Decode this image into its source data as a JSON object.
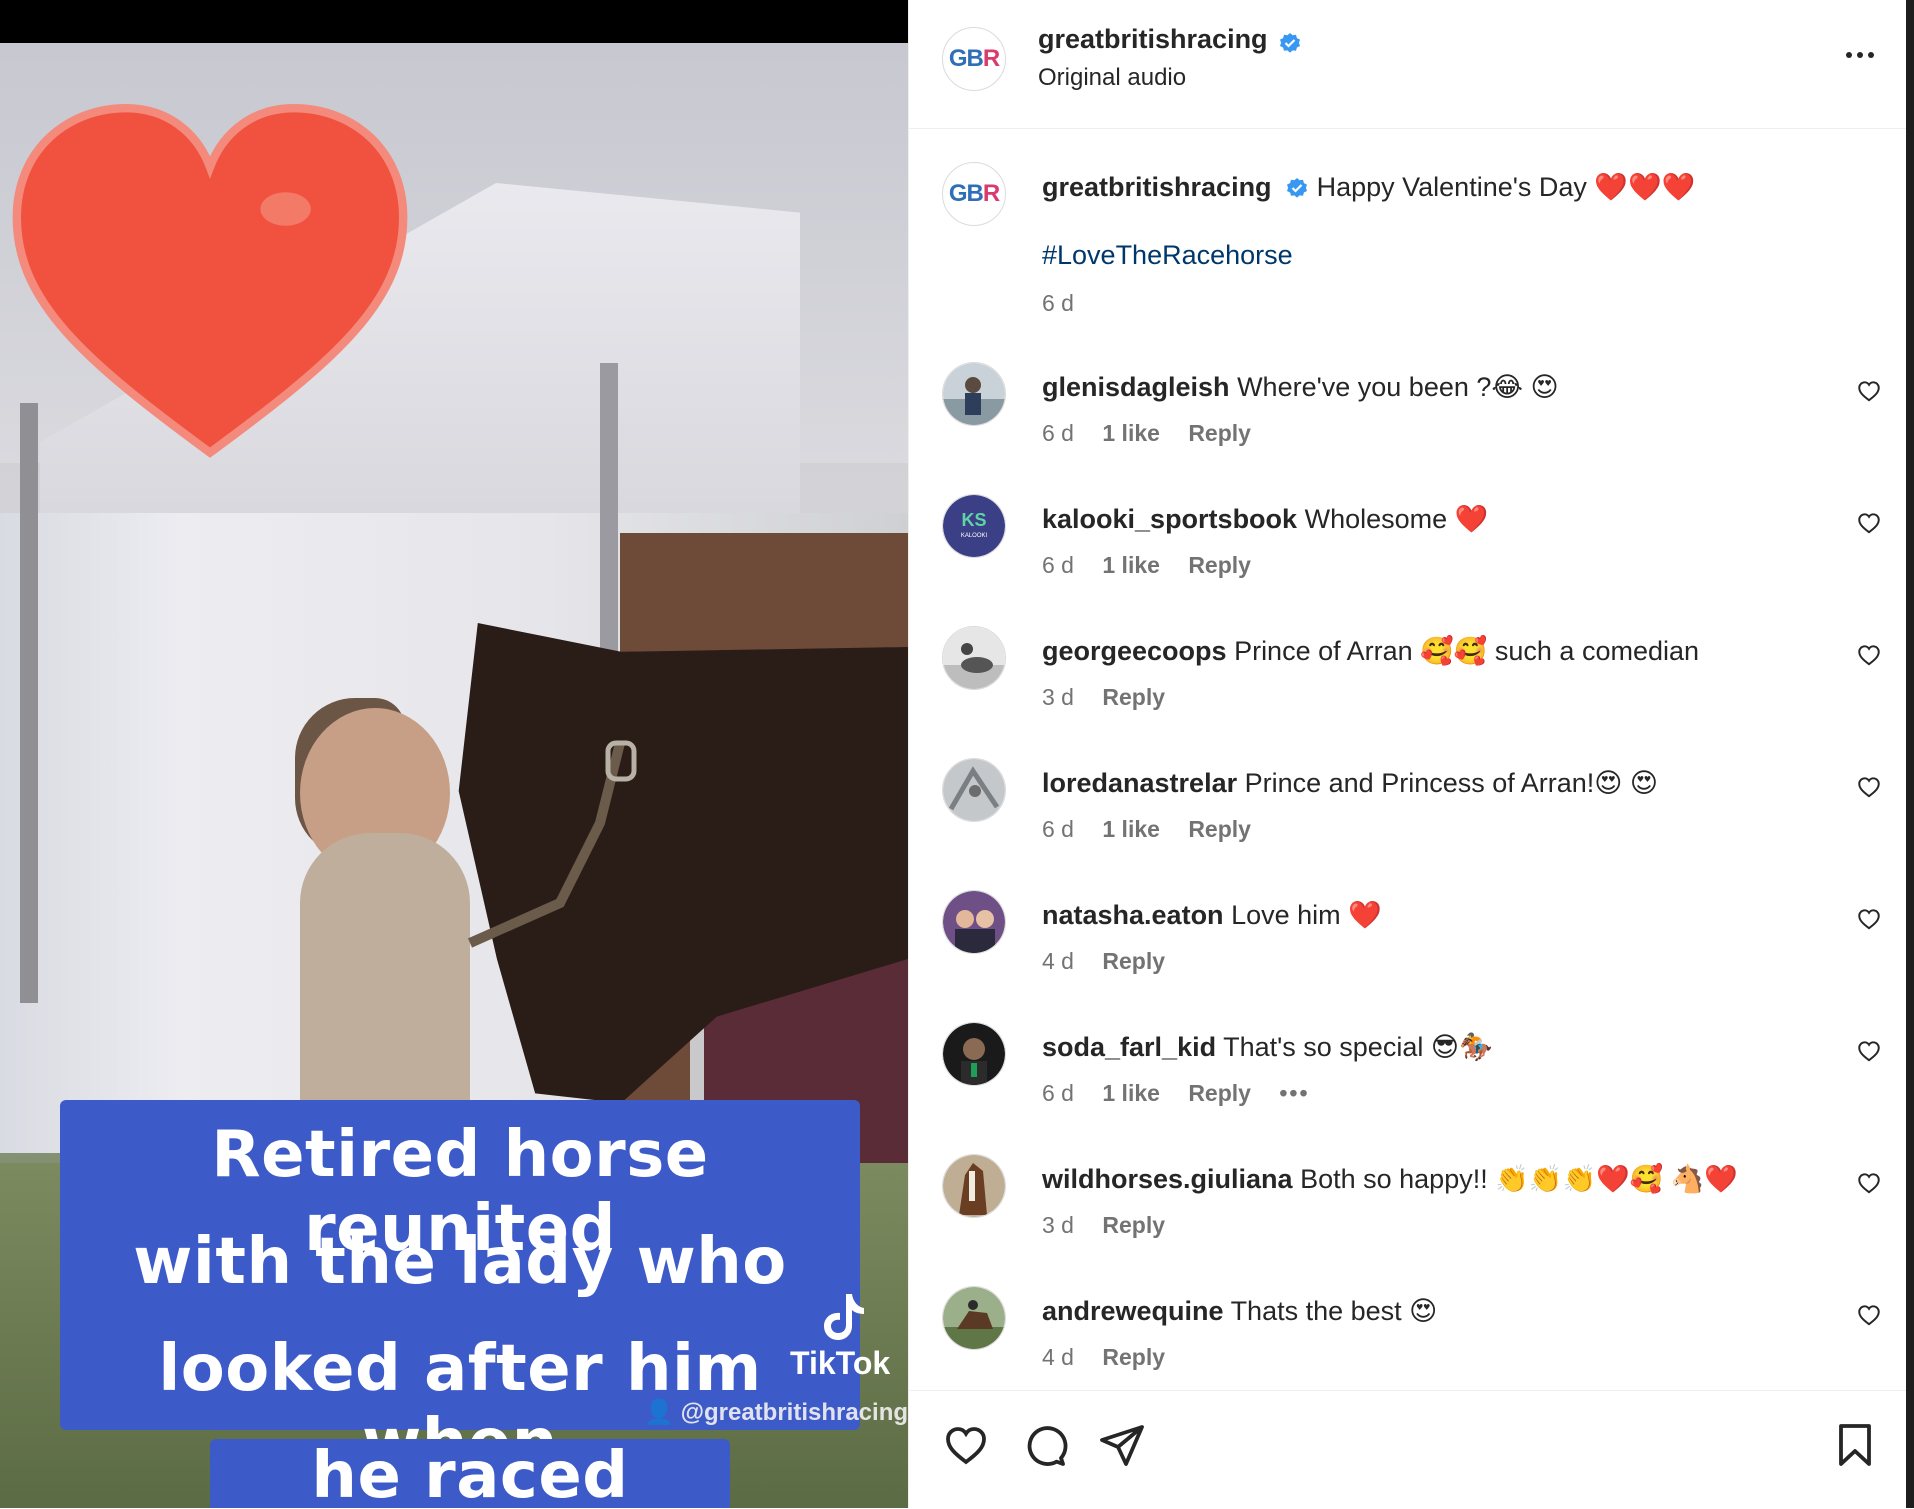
{
  "post": {
    "video_caption_lines": [
      "Retired horse reunited",
      "with the lady who",
      "looked after him when",
      "he raced"
    ],
    "tiktok_brand": "TikTok",
    "tiktok_handle": "@greatbritishracing"
  },
  "header": {
    "username": "greatbritishracing",
    "subtitle": "Original audio",
    "avatar_text": "GBR"
  },
  "caption": {
    "username": "greatbritishracing",
    "text": "Happy Valentine's Day ❤️❤️❤️",
    "hashtag": "#LoveTheRacehorse",
    "time": "6 d"
  },
  "comments": [
    {
      "user": "glenisdagleish",
      "text": "Where've you been ?😂 😍",
      "time": "6 d",
      "likes": "1 like",
      "reply": "Reply"
    },
    {
      "user": "kalooki_sportsbook",
      "text": "Wholesome ❤️",
      "time": "6 d",
      "likes": "1 like",
      "reply": "Reply"
    },
    {
      "user": "georgeecoops",
      "text": "Prince of Arran 🥰🥰 such a comedian",
      "time": "3 d",
      "likes": "",
      "reply": "Reply"
    },
    {
      "user": "loredanastrelar",
      "text": "Prince and Princess of Arran!😍 😍",
      "time": "6 d",
      "likes": "1 like",
      "reply": "Reply"
    },
    {
      "user": "natasha.eaton",
      "text": "Love him ❤️",
      "time": "4 d",
      "likes": "",
      "reply": "Reply"
    },
    {
      "user": "soda_farl_kid",
      "text": "That's so special 😎🏇",
      "time": "6 d",
      "likes": "1 like",
      "reply": "Reply"
    },
    {
      "user": "wildhorses.giuliana",
      "text": "Both so happy!! 👏👏👏❤️🥰 🐴❤️",
      "time": "3 d",
      "likes": "",
      "reply": "Reply"
    },
    {
      "user": "andrewequine",
      "text": "Thats the best 😍",
      "time": "4 d",
      "likes": "",
      "reply": "Reply"
    }
  ],
  "colors": {
    "verified": "#3897f0",
    "link": "#00376b",
    "muted": "#737373",
    "caption_bg": "#3d5ac9"
  },
  "icons": [
    "heart-icon",
    "comment-icon",
    "share-icon",
    "bookmark-icon",
    "more-icon",
    "verified-icon"
  ]
}
